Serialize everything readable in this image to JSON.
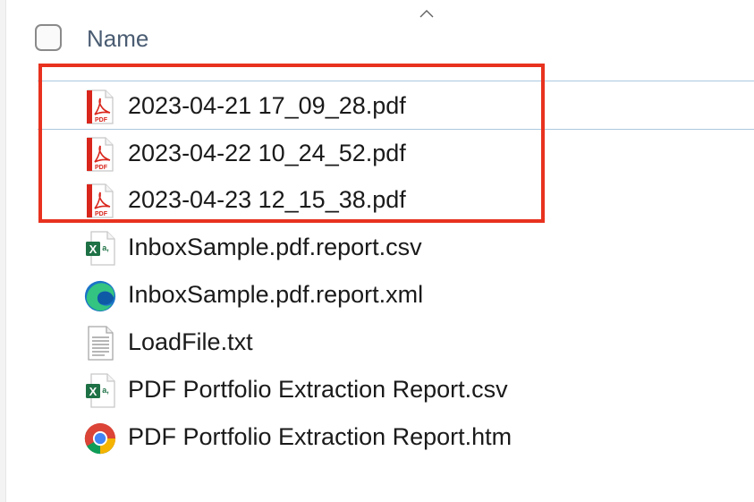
{
  "header": {
    "name_label": "Name",
    "sort": "ascending"
  },
  "files": [
    {
      "name": "2023-04-21 17_09_28.pdf",
      "icon": "pdf-icon",
      "selected": true
    },
    {
      "name": "2023-04-22 10_24_52.pdf",
      "icon": "pdf-icon",
      "selected": true
    },
    {
      "name": "2023-04-23 12_15_38.pdf",
      "icon": "pdf-icon",
      "selected": true
    },
    {
      "name": "InboxSample.pdf.report.csv",
      "icon": "excel-icon",
      "selected": false
    },
    {
      "name": "InboxSample.pdf.report.xml",
      "icon": "edge-icon",
      "selected": false
    },
    {
      "name": "LoadFile.txt",
      "icon": "text-file-icon",
      "selected": false
    },
    {
      "name": "PDF Portfolio Extraction Report.csv",
      "icon": "excel-icon",
      "selected": false
    },
    {
      "name": "PDF Portfolio Extraction Report.htm",
      "icon": "chrome-icon",
      "selected": false
    }
  ],
  "colors": {
    "highlight": "#e8321f",
    "pdf_red": "#d9261c",
    "excel_green": "#1e7145"
  },
  "pdf_badge": "PDF",
  "excel_badge": "X"
}
